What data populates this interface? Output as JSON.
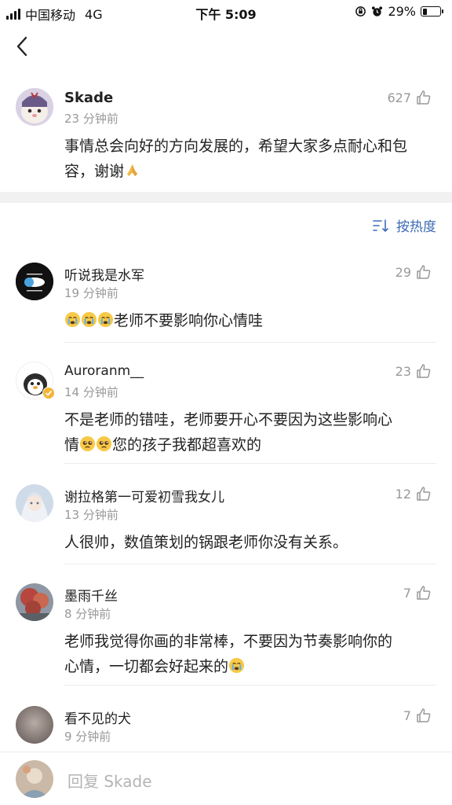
{
  "status_bar": {
    "carrier": "中国移动",
    "network": "4G",
    "time": "下午 5:09",
    "battery": "29%",
    "battery_level": 0.29
  },
  "main_comment": {
    "username": "Skade",
    "time": "23 分钟前",
    "likes": "627",
    "text": "事情总会向好的方向发展的，希望大家多点耐心和包容，谢谢",
    "emoji": "pray-hands-icon"
  },
  "sort": {
    "label": "按热度"
  },
  "comments": [
    {
      "username": "听说我是水军",
      "time": "19 分钟前",
      "likes": "29",
      "text": "老师不要影响你心情哇",
      "lead_emojis": [
        "crying-face-icon",
        "crying-face-icon",
        "crying-face-icon"
      ]
    },
    {
      "username": "Auroranm__",
      "time": "14 分钟前",
      "likes": "23",
      "text_line1": "不是老师的错哇，老师要开心不要因为这些影响心",
      "text_line2_pre": "情",
      "text_line2_post": "您的孩子我都超喜欢的",
      "mid_emojis": [
        "pleading-face-icon",
        "pleading-face-icon"
      ]
    },
    {
      "username": "谢拉格第一可爱初雪我女儿",
      "time": "13 分钟前",
      "likes": "12",
      "text": "人很帅，数值策划的锅跟老师你没有关系。"
    },
    {
      "username": "墨雨千丝",
      "time": "8 分钟前",
      "likes": "7",
      "text_line1": "老师我觉得你画的非常棒，不要因为节奏影响你的",
      "text_line2": "心情，一切都会好起来的",
      "trail_emoji": "crying-face-icon"
    },
    {
      "username": "看不见的犬",
      "time": "9 分钟前",
      "likes": "7"
    }
  ],
  "reply_bar": {
    "placeholder": "回复 Skade"
  },
  "colors": {
    "accent": "#3d6bb5",
    "muted": "#999999",
    "separator": "#f1f1f1"
  }
}
